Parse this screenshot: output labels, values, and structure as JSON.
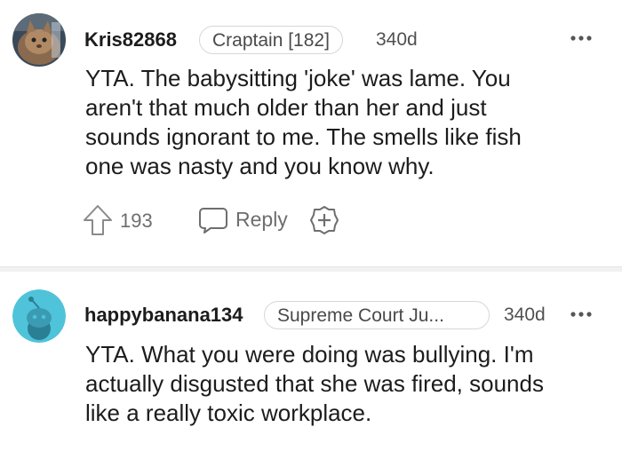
{
  "comments": [
    {
      "username": "Kris82868",
      "flair": "Craptain [182]",
      "age": "340d",
      "avatar_icon": "cat-photo-avatar",
      "body_lines": [
        "YTA. The babysitting 'joke' was lame. You",
        "aren't that much older than her and just",
        "sounds ignorant to me. The smells like fish",
        "one was nasty and you know why."
      ],
      "votes": "193",
      "reply_label": "Reply"
    },
    {
      "username": "happybanana134",
      "flair": "Supreme Court Ju...",
      "age": "340d",
      "avatar_icon": "snoo-avatar",
      "body_lines": [
        "YTA. What you were doing was bullying. I'm",
        "actually disgusted that she was fired, sounds",
        "like a really toxic workplace."
      ]
    }
  ],
  "colors": {
    "text": "#1c1c1c",
    "meta": "#6e6e6e",
    "snoo_bg": "#4fc3d9",
    "divider": "#f1f1f1"
  }
}
